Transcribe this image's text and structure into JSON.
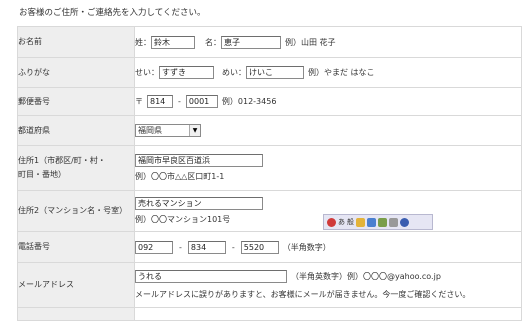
{
  "intro": "お客様のご住所・ご連絡先を入力してください。",
  "rows": {
    "name": {
      "label": "お名前",
      "sei_label": "姓：",
      "sei_value": "鈴木",
      "mei_label": "名：",
      "mei_value": "恵子",
      "example": "例）山田 花子"
    },
    "kana": {
      "label": "ふりがな",
      "sei_label": "せい：",
      "sei_value": "すずき",
      "mei_label": "めい：",
      "mei_value": "けいこ",
      "example": "例）やまだ はなこ"
    },
    "zip": {
      "label": "郵便番号",
      "mark": "〒",
      "first": "814",
      "dash": "-",
      "second": "0001",
      "example": "例）012-3456"
    },
    "pref": {
      "label": "都道府県",
      "selected": "福岡県"
    },
    "addr1": {
      "label_line1": "住所1（市郡区/町・村・",
      "label_line2": "町目・番地）",
      "value": "福岡市早良区百道浜",
      "example": "例）〇〇市△△区口町1-1"
    },
    "addr2": {
      "label": "住所2（マンション名・号室）",
      "value": "売れるマンション",
      "example": "例）〇〇マンション101号"
    },
    "tel": {
      "label": "電話番号",
      "p1": "092",
      "p2": "834",
      "p3": "5520",
      "dash": "-",
      "note": "（半角数字）"
    },
    "mail": {
      "label": "メールアドレス",
      "value": "うれる",
      "note": "（半角英数字）例）〇〇〇@yahoo.co.jp",
      "warning": "メールアドレスに誤りがありますと、お客様にメールが届きません。今一度ご確認ください。"
    }
  },
  "ime_toolbar": {
    "mode": "あ",
    "kanji": "般"
  }
}
